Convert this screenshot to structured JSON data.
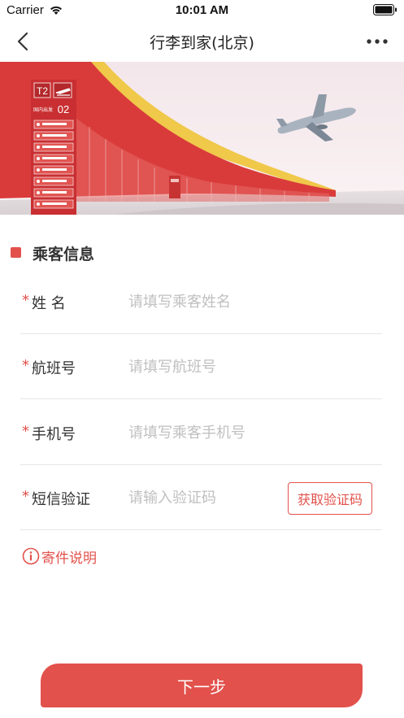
{
  "status_bar": {
    "carrier": "Carrier",
    "time": "10:01 AM"
  },
  "nav": {
    "title": "行李到家(北京)"
  },
  "banner": {
    "terminal": "T2",
    "sign_text": "国内出发",
    "gate": "02"
  },
  "section": {
    "title": "乘客信息"
  },
  "form": {
    "required_mark": "*",
    "name": {
      "label": "姓 名",
      "placeholder": "请填写乘客姓名",
      "value": ""
    },
    "flight": {
      "label": "航班号",
      "placeholder": "请填写航班号",
      "value": ""
    },
    "phone": {
      "label": "手机号",
      "placeholder": "请填写乘客手机号",
      "value": ""
    },
    "sms": {
      "label": "短信验证",
      "placeholder": "请输入验证码",
      "value": "",
      "button_label": "获取验证码"
    }
  },
  "info": {
    "label": "寄件说明",
    "icon": "info-icon"
  },
  "next": {
    "label": "下一步"
  },
  "colors": {
    "accent": "#e2514b",
    "placeholder": "#c0c0c0",
    "divider": "#e5e5e5"
  }
}
